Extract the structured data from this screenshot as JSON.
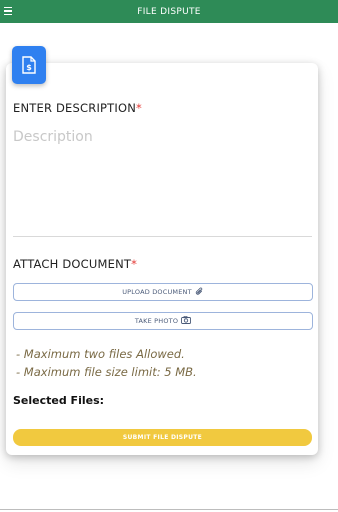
{
  "header": {
    "title": "FILE DISPUTE"
  },
  "description": {
    "label": "ENTER DESCRIPTION",
    "required_mark": "*",
    "placeholder": "Description",
    "value": ""
  },
  "attach": {
    "label": "ATTACH DOCUMENT",
    "required_mark": "*",
    "upload_label": "UPLOAD DOCUMENT",
    "take_photo_label": "TAKE PHOTO"
  },
  "notes": [
    "- Maximum two files Allowed.",
    "- Maximum file size limit: 5 MB."
  ],
  "selected_files_label": "Selected Files:",
  "submit_label": "SUBMIT FILE DISPUTE",
  "colors": {
    "header": "#2e8b57",
    "badge": "#2f80f0",
    "submit": "#f1c93f",
    "required": "#e53935"
  },
  "icons": {
    "menu": "hamburger-icon",
    "badge": "document-dollar-icon",
    "upload": "paperclip-icon",
    "photo": "camera-icon"
  }
}
